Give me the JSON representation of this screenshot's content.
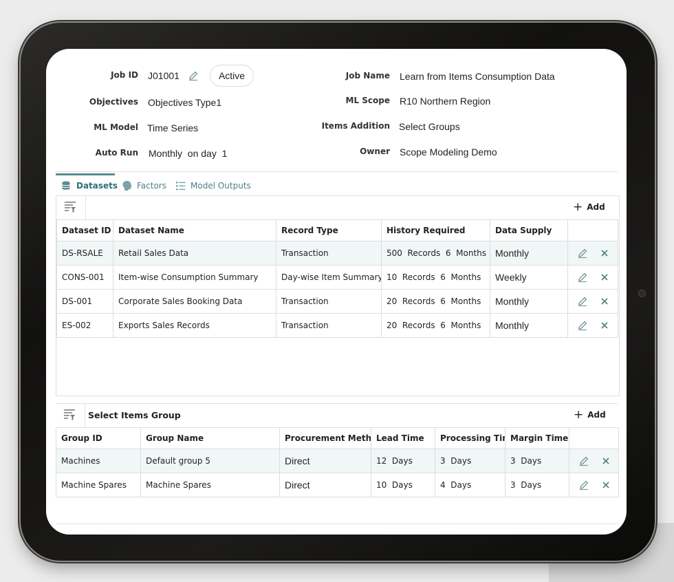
{
  "job": {
    "job_id_label": "Job ID",
    "job_id": "J01001",
    "status": "Active",
    "objectives_label": "Objectives",
    "objectives": "Objectives Type1",
    "ml_model_label": "ML Model",
    "ml_model": "Time Series",
    "auto_run_label": "Auto Run",
    "auto_run": "Monthly  on day  1",
    "job_name_label": "Job Name",
    "job_name": "Learn from Items Consumption Data",
    "ml_scope_label": "ML Scope",
    "ml_scope": "R10 Northern Region",
    "items_addition_label": "Items Addition",
    "items_addition": "Select Groups",
    "owner_label": "Owner",
    "owner": "Scope Modeling Demo"
  },
  "tabs": [
    {
      "label": "Datasets",
      "icon": "database-icon",
      "active": true
    },
    {
      "label": "Factors",
      "icon": "head-icon",
      "active": false
    },
    {
      "label": "Model Outputs",
      "icon": "list-icon",
      "active": false
    }
  ],
  "datasets": {
    "add_label": "Add",
    "columns": [
      "Dataset ID",
      "Dataset Name",
      "Record Type",
      "History Required",
      "Data Supply"
    ],
    "rows": [
      [
        "DS-RSALE",
        "Retail Sales Data",
        "Transaction",
        "500  Records  6  Months",
        "Monthly"
      ],
      [
        "CONS-001",
        "Item-wise Consumption Summary",
        "Day-wise Item Summary",
        "10  Records  6  Months",
        "Weekly"
      ],
      [
        "DS-001",
        "Corporate Sales Booking Data",
        "Transaction",
        "20  Records  6  Months",
        "Monthly"
      ],
      [
        "ES-002",
        "Exports Sales Records",
        "Transaction",
        "20  Records  6  Months",
        "Monthly"
      ]
    ]
  },
  "items_group": {
    "title": "Select Items Group",
    "add_label": "Add",
    "columns": [
      "Group ID",
      "Group Name",
      "Procurement Method",
      "Lead Time",
      "Processing Time",
      "Margin Time"
    ],
    "rows": [
      [
        "Machines",
        "Default group 5",
        "Direct",
        "12  Days",
        "3  Days",
        "3  Days"
      ],
      [
        "Machine Spares",
        "Machine Spares",
        "Direct",
        "10  Days",
        "4  Days",
        "3  Days"
      ]
    ]
  },
  "colors": {
    "accent": "#4f7e84",
    "row_highlight": "#f1f6f6"
  }
}
